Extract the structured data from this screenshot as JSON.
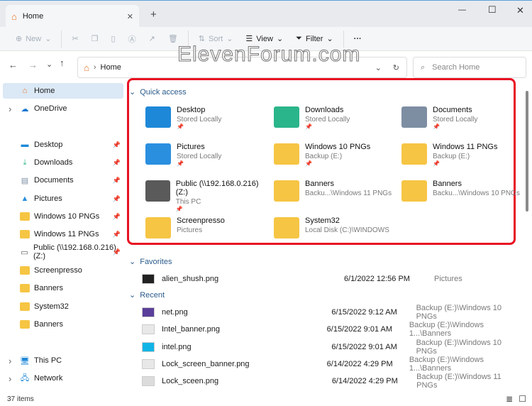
{
  "window": {
    "tab_title": "Home",
    "new_tab": "+",
    "min": "—",
    "max": "☐",
    "close": "✕"
  },
  "toolbar": {
    "new": "New",
    "sort": "Sort",
    "view": "View",
    "filter": "Filter",
    "more": "···"
  },
  "address": {
    "crumb": "Home",
    "search_placeholder": "Search Home"
  },
  "watermark": "ElevenForum.com",
  "sidebar": {
    "items": [
      {
        "label": "Home"
      },
      {
        "label": "OneDrive"
      },
      {
        "label": "Desktop"
      },
      {
        "label": "Downloads"
      },
      {
        "label": "Documents"
      },
      {
        "label": "Pictures"
      },
      {
        "label": "Windows 10 PNGs"
      },
      {
        "label": "Windows 11 PNGs"
      },
      {
        "label": "Public (\\\\192.168.0.216) (Z:)"
      },
      {
        "label": "Screenpresso"
      },
      {
        "label": "Banners"
      },
      {
        "label": "System32"
      },
      {
        "label": "Banners"
      },
      {
        "label": "This PC"
      },
      {
        "label": "Network"
      }
    ]
  },
  "quick_access": {
    "title": "Quick access",
    "items": [
      {
        "name": "Desktop",
        "sub": "Stored Locally",
        "pinned": true,
        "color": "#1e88d8"
      },
      {
        "name": "Downloads",
        "sub": "Stored Locally",
        "pinned": true,
        "color": "#2bb58a"
      },
      {
        "name": "Documents",
        "sub": "Stored Locally",
        "pinned": true,
        "color": "#7d8ea3"
      },
      {
        "name": "Pictures",
        "sub": "Stored Locally",
        "pinned": true,
        "color": "#2b8fe0"
      },
      {
        "name": "Windows 10 PNGs",
        "sub": "Backup (E:)",
        "pinned": true,
        "color": "#f6c544"
      },
      {
        "name": "Windows 11 PNGs",
        "sub": "Backup (E:)",
        "pinned": true,
        "color": "#f6c544"
      },
      {
        "name": "Public (\\\\192.168.0.216) (Z:)",
        "sub": "This PC",
        "pinned": true,
        "color": "#5a5a5a"
      },
      {
        "name": "Banners",
        "sub": "Backu...\\Windows 11 PNGs",
        "pinned": false,
        "color": "#f6c544"
      },
      {
        "name": "Banners",
        "sub": "Backu...\\Windows 10 PNGs",
        "pinned": false,
        "color": "#f6c544"
      },
      {
        "name": "Screenpresso",
        "sub": "Pictures",
        "pinned": false,
        "color": "#f6c544"
      },
      {
        "name": "System32",
        "sub": "Local Disk (C:)\\WINDOWS",
        "pinned": false,
        "color": "#f6c544"
      }
    ]
  },
  "favorites": {
    "title": "Favorites",
    "items": [
      {
        "name": "alien_shush.png",
        "date": "6/1/2022 12:56 PM",
        "location": "Pictures"
      }
    ]
  },
  "recent": {
    "title": "Recent",
    "items": [
      {
        "name": "net.png",
        "date": "6/15/2022 9:12 AM",
        "location": "Backup (E:)\\Windows 10 PNGs",
        "color": "#5b3e99"
      },
      {
        "name": "Intel_banner.png",
        "date": "6/15/2022 9:01 AM",
        "location": "Backup (E:)\\Windows 1...\\Banners",
        "color": "#e8e8e8"
      },
      {
        "name": "intel.png",
        "date": "6/15/2022 9:01 AM",
        "location": "Backup (E:)\\Windows 10 PNGs",
        "color": "#0fb4e6"
      },
      {
        "name": "Lock_screen_banner.png",
        "date": "6/14/2022 4:29 PM",
        "location": "Backup (E:)\\Windows 1...\\Banners",
        "color": "#e8e8e8"
      },
      {
        "name": "Lock_sceen.png",
        "date": "6/14/2022 4:29 PM",
        "location": "Backup (E:)\\Windows 11 PNGs",
        "color": "#dcdcdc"
      }
    ]
  },
  "status": {
    "count": "37 items"
  }
}
